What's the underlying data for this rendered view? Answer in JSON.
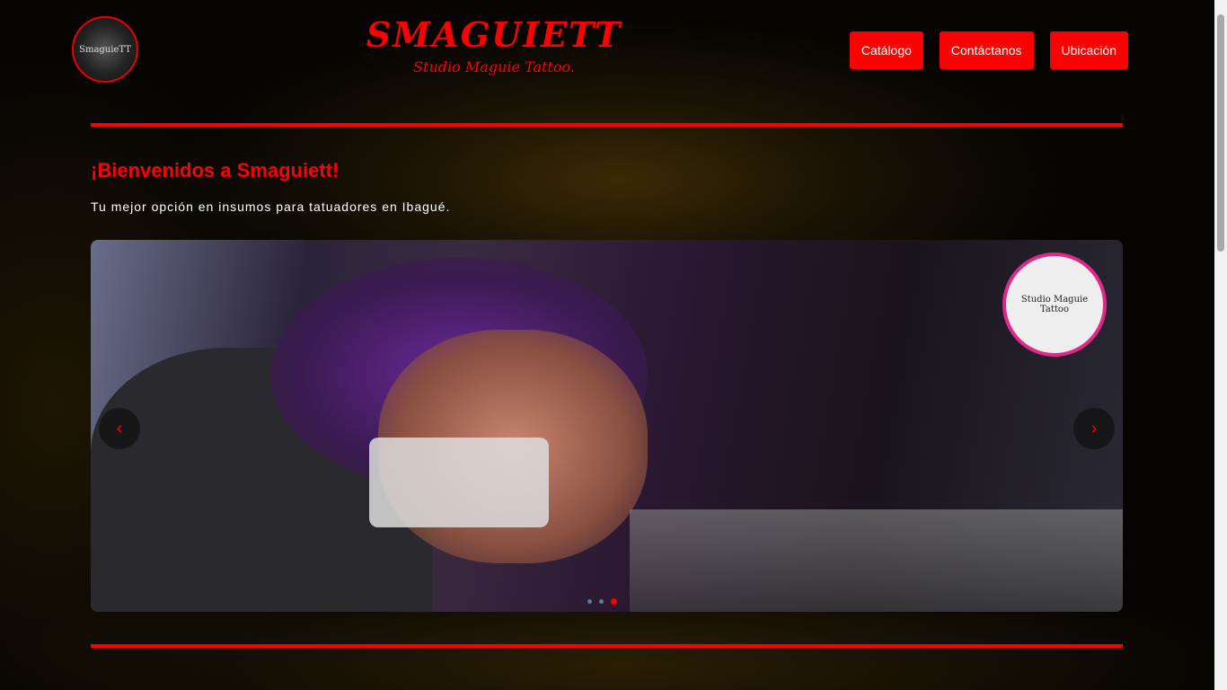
{
  "header": {
    "logo_text": "SmaguieTT",
    "brand_title": "SMAGUIETT",
    "brand_subtitle": "Studio Maguie Tattoo.",
    "nav": [
      {
        "label": "Catálogo"
      },
      {
        "label": "Contáctanos"
      },
      {
        "label": "Ubicación"
      }
    ]
  },
  "main": {
    "title": "¡Bienvenidos a Smaguiett!",
    "subtitle": "Tu mejor opción en insumos para tatuadores en Ibagué."
  },
  "carousel": {
    "badge_text": "Studio Maguie Tattoo",
    "prev": "‹",
    "next": "›",
    "slide_count": 3,
    "active_index": 2
  },
  "colors": {
    "accent": "#ff0000"
  }
}
